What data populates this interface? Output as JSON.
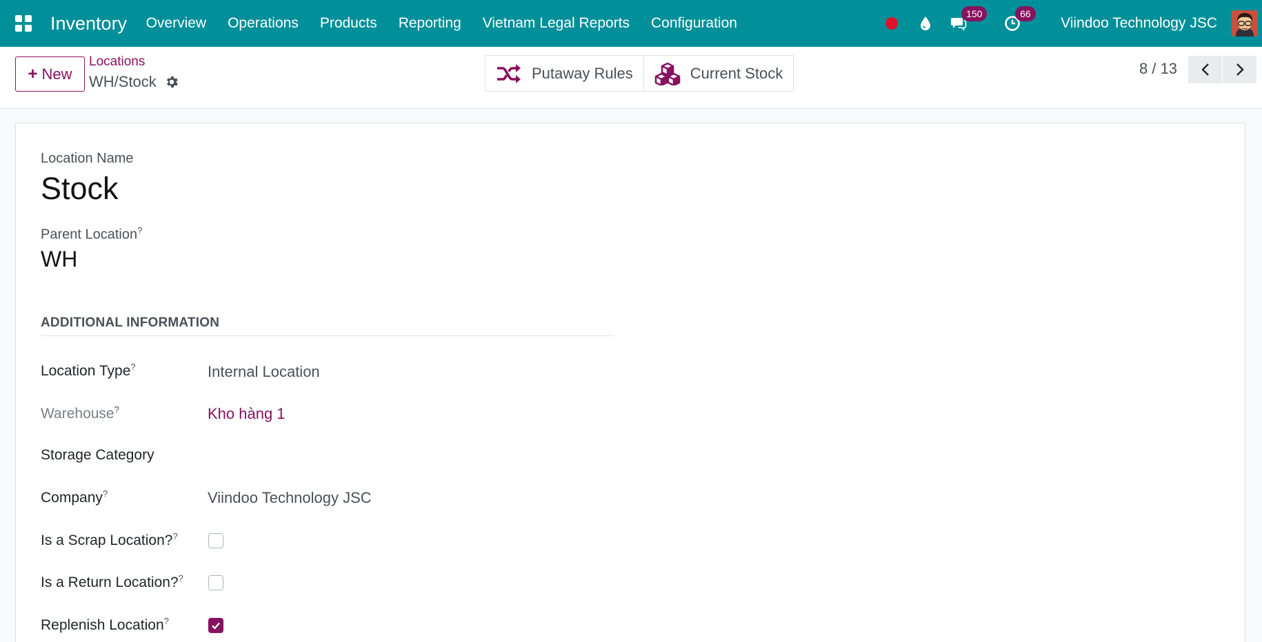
{
  "navbar": {
    "app_name": "Inventory",
    "menu": [
      "Overview",
      "Operations",
      "Products",
      "Reporting",
      "Vietnam Legal Reports",
      "Configuration"
    ],
    "messages_count": "150",
    "activities_count": "66",
    "company": "Viindoo Technology JSC",
    "accent_color": "#018f99"
  },
  "control_panel": {
    "new_label": "New",
    "breadcrumb": "Locations",
    "record_name": "WH/Stock",
    "smart_buttons": [
      "Putaway Rules",
      "Current Stock"
    ],
    "pager": "8 / 13"
  },
  "form": {
    "location_name_label": "Location Name",
    "location_name": "Stock",
    "parent_location_label": "Parent Location",
    "parent_location": "WH",
    "help_mark": "?",
    "section_title": "ADDITIONAL INFORMATION",
    "location_type_label": "Location Type",
    "location_type": "Internal Location",
    "warehouse_label": "Warehouse",
    "warehouse": "Kho hàng 1",
    "storage_category_label": "Storage Category",
    "company_label": "Company",
    "company": "Viindoo Technology JSC",
    "scrap_label": "Is a Scrap Location?",
    "scrap_checked": false,
    "return_label": "Is a Return Location?",
    "return_checked": false,
    "replenish_label": "Replenish Location",
    "replenish_checked": true,
    "primary_color": "#87125f"
  }
}
